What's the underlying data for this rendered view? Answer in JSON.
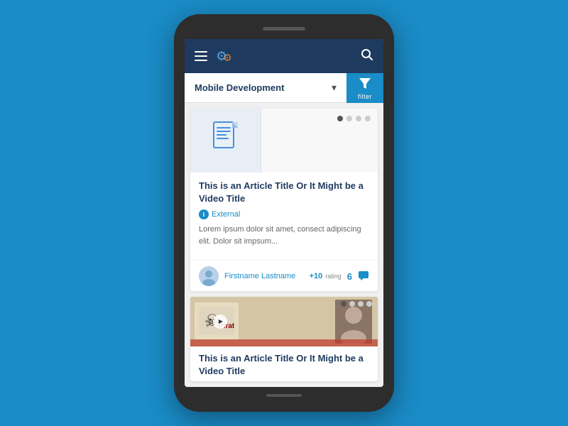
{
  "phone": {
    "speaker_visible": true
  },
  "topbar": {
    "hamburger_label": "menu",
    "logo_gear_blue": "⚙",
    "logo_gear_orange": "⚙",
    "search_label": "search"
  },
  "category_bar": {
    "selected_category": "Mobile Development",
    "chevron": "▾",
    "filter_label": "filter"
  },
  "card1": {
    "doc_icon": "📄",
    "dots": [
      true,
      false,
      false,
      false
    ],
    "title": "This is an Article Title Or It Might be a Video Title",
    "tag_icon": "i",
    "tag_label": "External",
    "excerpt": "Lorem ipsum dolor sit amet, consect adipiscing elit. Dolor sit impsum...",
    "author_name": "Firstname Lastname",
    "rating_value": "+10",
    "rating_text": "rating",
    "comment_count": "6"
  },
  "card2": {
    "dots": [
      true,
      false,
      false,
      false
    ],
    "title": "This is an Article Title Or It Might be a Video Title",
    "play_icon": "▶"
  }
}
